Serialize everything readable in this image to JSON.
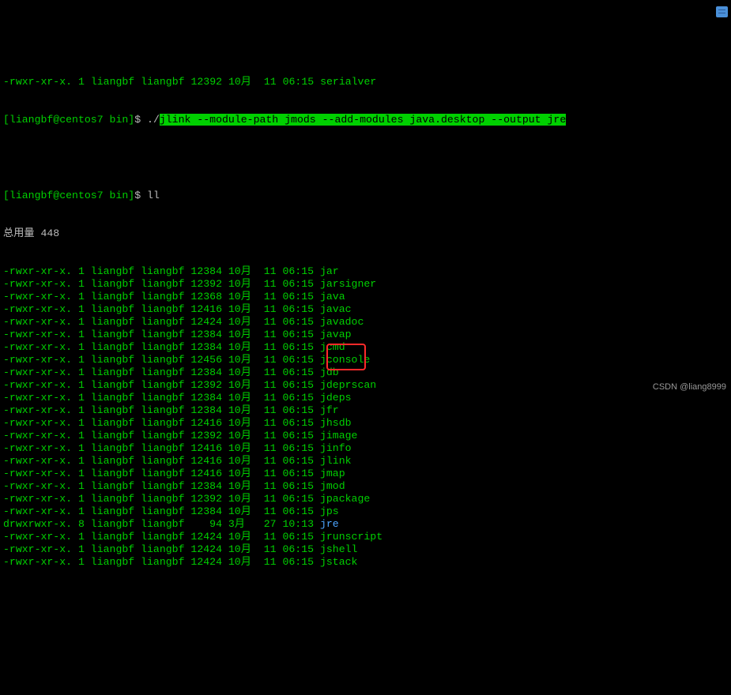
{
  "truncated_top": {
    "perm": "-rwxr-xr-x.",
    "links": "1",
    "owner": "liangbf",
    "group": "liangbf",
    "size": "12392",
    "month": "10月",
    "day": "11",
    "time": "06:15",
    "name": "serialver"
  },
  "prompt1": {
    "user_host": "[liangbf@centos7 bin]",
    "dollar": "$ ",
    "typed_prefix": "./",
    "highlighted": "jlink --module-path jmods --add-modules java.desktop --output jre"
  },
  "blank": "",
  "prompt2": {
    "user_host": "[liangbf@centos7 bin]",
    "dollar": "$ ",
    "cmd": "ll"
  },
  "total_line": "总用量 448",
  "files": [
    {
      "perm": "-rwxr-xr-x.",
      "links": "1",
      "owner": "liangbf",
      "group": "liangbf",
      "size": "12384",
      "month": "10月",
      "day": "11",
      "time": "06:15",
      "name": "jar",
      "dir": false
    },
    {
      "perm": "-rwxr-xr-x.",
      "links": "1",
      "owner": "liangbf",
      "group": "liangbf",
      "size": "12392",
      "month": "10月",
      "day": "11",
      "time": "06:15",
      "name": "jarsigner",
      "dir": false
    },
    {
      "perm": "-rwxr-xr-x.",
      "links": "1",
      "owner": "liangbf",
      "group": "liangbf",
      "size": "12368",
      "month": "10月",
      "day": "11",
      "time": "06:15",
      "name": "java",
      "dir": false
    },
    {
      "perm": "-rwxr-xr-x.",
      "links": "1",
      "owner": "liangbf",
      "group": "liangbf",
      "size": "12416",
      "month": "10月",
      "day": "11",
      "time": "06:15",
      "name": "javac",
      "dir": false
    },
    {
      "perm": "-rwxr-xr-x.",
      "links": "1",
      "owner": "liangbf",
      "group": "liangbf",
      "size": "12424",
      "month": "10月",
      "day": "11",
      "time": "06:15",
      "name": "javadoc",
      "dir": false
    },
    {
      "perm": "-rwxr-xr-x.",
      "links": "1",
      "owner": "liangbf",
      "group": "liangbf",
      "size": "12384",
      "month": "10月",
      "day": "11",
      "time": "06:15",
      "name": "javap",
      "dir": false
    },
    {
      "perm": "-rwxr-xr-x.",
      "links": "1",
      "owner": "liangbf",
      "group": "liangbf",
      "size": "12384",
      "month": "10月",
      "day": "11",
      "time": "06:15",
      "name": "jcmd",
      "dir": false
    },
    {
      "perm": "-rwxr-xr-x.",
      "links": "1",
      "owner": "liangbf",
      "group": "liangbf",
      "size": "12456",
      "month": "10月",
      "day": "11",
      "time": "06:15",
      "name": "jconsole",
      "dir": false
    },
    {
      "perm": "-rwxr-xr-x.",
      "links": "1",
      "owner": "liangbf",
      "group": "liangbf",
      "size": "12384",
      "month": "10月",
      "day": "11",
      "time": "06:15",
      "name": "jdb",
      "dir": false
    },
    {
      "perm": "-rwxr-xr-x.",
      "links": "1",
      "owner": "liangbf",
      "group": "liangbf",
      "size": "12392",
      "month": "10月",
      "day": "11",
      "time": "06:15",
      "name": "jdeprscan",
      "dir": false
    },
    {
      "perm": "-rwxr-xr-x.",
      "links": "1",
      "owner": "liangbf",
      "group": "liangbf",
      "size": "12384",
      "month": "10月",
      "day": "11",
      "time": "06:15",
      "name": "jdeps",
      "dir": false
    },
    {
      "perm": "-rwxr-xr-x.",
      "links": "1",
      "owner": "liangbf",
      "group": "liangbf",
      "size": "12384",
      "month": "10月",
      "day": "11",
      "time": "06:15",
      "name": "jfr",
      "dir": false
    },
    {
      "perm": "-rwxr-xr-x.",
      "links": "1",
      "owner": "liangbf",
      "group": "liangbf",
      "size": "12416",
      "month": "10月",
      "day": "11",
      "time": "06:15",
      "name": "jhsdb",
      "dir": false
    },
    {
      "perm": "-rwxr-xr-x.",
      "links": "1",
      "owner": "liangbf",
      "group": "liangbf",
      "size": "12392",
      "month": "10月",
      "day": "11",
      "time": "06:15",
      "name": "jimage",
      "dir": false
    },
    {
      "perm": "-rwxr-xr-x.",
      "links": "1",
      "owner": "liangbf",
      "group": "liangbf",
      "size": "12416",
      "month": "10月",
      "day": "11",
      "time": "06:15",
      "name": "jinfo",
      "dir": false
    },
    {
      "perm": "-rwxr-xr-x.",
      "links": "1",
      "owner": "liangbf",
      "group": "liangbf",
      "size": "12416",
      "month": "10月",
      "day": "11",
      "time": "06:15",
      "name": "jlink",
      "dir": false
    },
    {
      "perm": "-rwxr-xr-x.",
      "links": "1",
      "owner": "liangbf",
      "group": "liangbf",
      "size": "12416",
      "month": "10月",
      "day": "11",
      "time": "06:15",
      "name": "jmap",
      "dir": false
    },
    {
      "perm": "-rwxr-xr-x.",
      "links": "1",
      "owner": "liangbf",
      "group": "liangbf",
      "size": "12384",
      "month": "10月",
      "day": "11",
      "time": "06:15",
      "name": "jmod",
      "dir": false
    },
    {
      "perm": "-rwxr-xr-x.",
      "links": "1",
      "owner": "liangbf",
      "group": "liangbf",
      "size": "12392",
      "month": "10月",
      "day": "11",
      "time": "06:15",
      "name": "jpackage",
      "dir": false
    },
    {
      "perm": "-rwxr-xr-x.",
      "links": "1",
      "owner": "liangbf",
      "group": "liangbf",
      "size": "12384",
      "month": "10月",
      "day": "11",
      "time": "06:15",
      "name": "jps",
      "dir": false
    },
    {
      "perm": "drwxrwxr-x.",
      "links": "8",
      "owner": "liangbf",
      "group": "liangbf",
      "size": "94",
      "month": "3月",
      "day": "27",
      "time": "10:13",
      "name": "jre",
      "dir": true
    },
    {
      "perm": "-rwxr-xr-x.",
      "links": "1",
      "owner": "liangbf",
      "group": "liangbf",
      "size": "12424",
      "month": "10月",
      "day": "11",
      "time": "06:15",
      "name": "jrunscript",
      "dir": false
    },
    {
      "perm": "-rwxr-xr-x.",
      "links": "1",
      "owner": "liangbf",
      "group": "liangbf",
      "size": "12424",
      "month": "10月",
      "day": "11",
      "time": "06:15",
      "name": "jshell",
      "dir": false
    },
    {
      "perm": "-rwxr-xr-x.",
      "links": "1",
      "owner": "liangbf",
      "group": "liangbf",
      "size": "12424",
      "month": "10月",
      "day": "11",
      "time": "06:15",
      "name": "jstack",
      "dir": false
    }
  ],
  "watermark": "CSDN @liang8999"
}
